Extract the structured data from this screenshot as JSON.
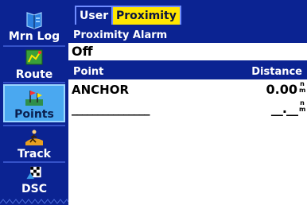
{
  "sidebar": {
    "items": [
      {
        "label": "Mrn Log",
        "icon": "log-book-icon",
        "selected": false
      },
      {
        "label": "Route",
        "icon": "route-map-icon",
        "selected": false
      },
      {
        "label": "Points",
        "icon": "waypoint-flag-icon",
        "selected": true
      },
      {
        "label": "Track",
        "icon": "track-runner-icon",
        "selected": false
      },
      {
        "label": "DSC",
        "icon": "dsc-radio-icon",
        "selected": false
      }
    ]
  },
  "tabs": [
    {
      "label": "User",
      "active": false
    },
    {
      "label": "Proximity",
      "active": true
    }
  ],
  "proximity_alarm": {
    "heading": "Proximity Alarm",
    "value": "Off"
  },
  "table": {
    "col_point": "Point",
    "col_distance": "Distance",
    "rows": [
      {
        "point": "ANCHOR",
        "distance": "0.00",
        "unit": "n m"
      },
      {
        "point": "_______________",
        "distance": "__.__",
        "unit": "n m"
      }
    ]
  },
  "colors": {
    "panel": "#0b2392",
    "selected_tab": "#ffe600",
    "selected_item": "#4aa8f0"
  }
}
